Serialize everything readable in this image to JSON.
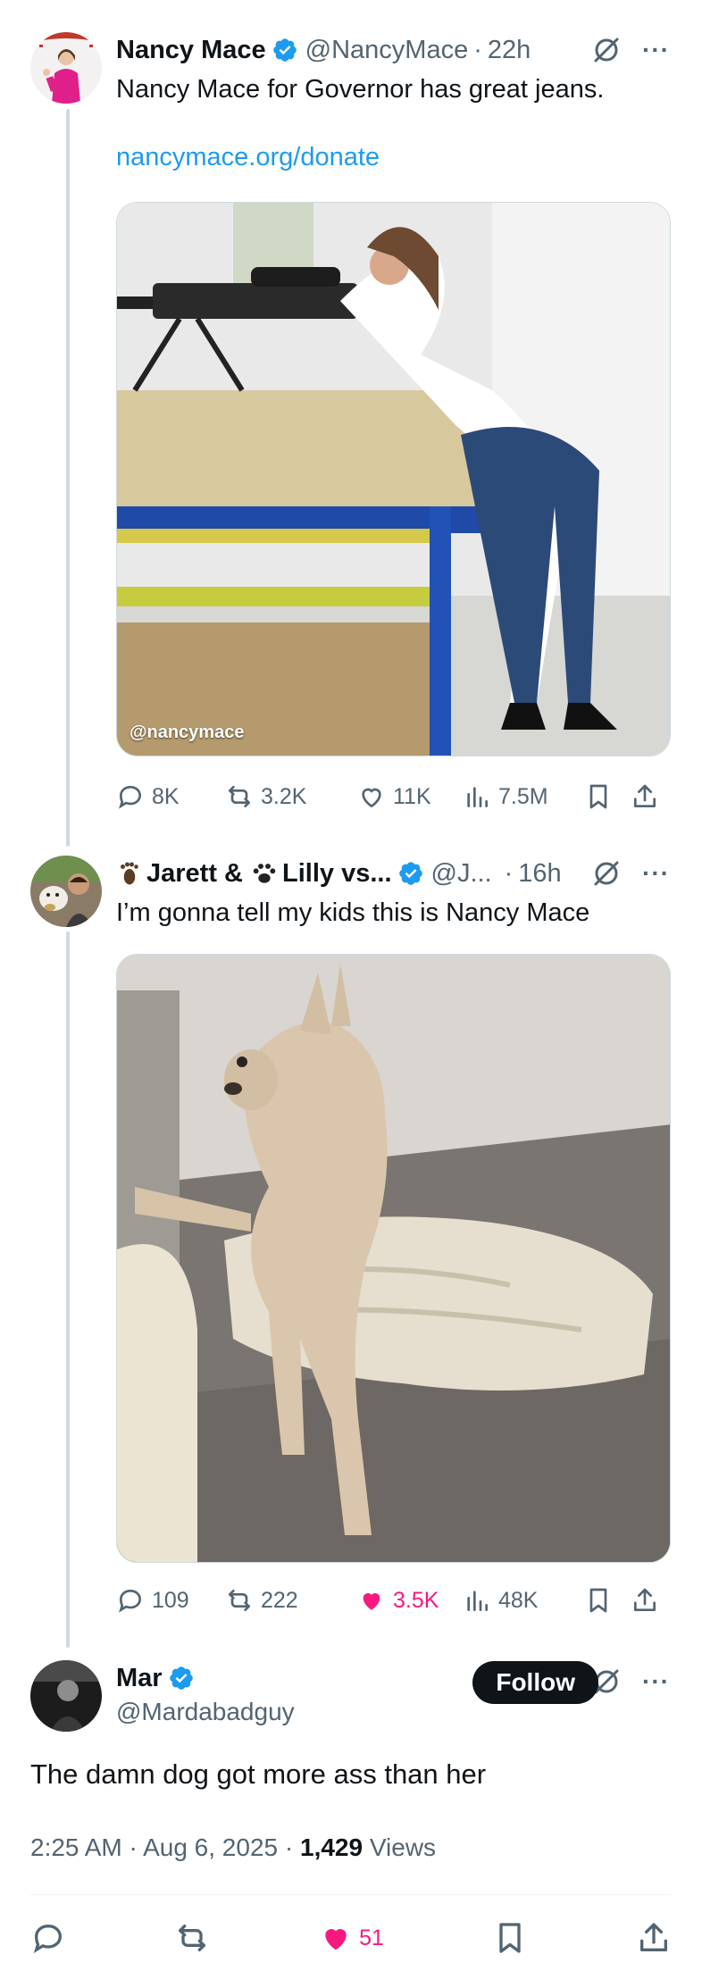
{
  "colors": {
    "text": "#0f1419",
    "secondary": "#536471",
    "link": "#1d9bf0",
    "like": "#f91880",
    "verified": "#1d9bf0",
    "thread_line": "#cfd9de"
  },
  "tweet1": {
    "name": "Nancy Mace",
    "handle": "@NancyMace",
    "time": "22h",
    "text": "Nancy Mace for Governor has great jeans.",
    "link": "nancymace.org/donate",
    "media_watermark": "@nancymace",
    "replies": "8K",
    "reposts": "3.2K",
    "likes": "11K",
    "views": "7.5M"
  },
  "tweet2": {
    "name_part1": "Jarett &",
    "name_part2": "Lilly vs...",
    "handle": "@J...",
    "time": "16h",
    "text": "I’m gonna tell my kids this is Nancy Mace",
    "replies": "109",
    "reposts": "222",
    "likes": "3.5K",
    "views": "48K"
  },
  "tweet3": {
    "name": "Mar",
    "handle": "@Mardabadguy",
    "follow_label": "Follow",
    "text": "The damn dog got more ass than her",
    "time": "2:25 AM",
    "date": "Aug 6, 2025",
    "views_count": "1,429",
    "views_label": "Views",
    "likes": "51"
  },
  "icons": [
    "verified-icon",
    "grok-icon",
    "more-icon",
    "reply-icon",
    "repost-icon",
    "like-icon",
    "views-icon",
    "bookmark-icon",
    "share-icon",
    "footprint-icon",
    "paw-icon"
  ]
}
